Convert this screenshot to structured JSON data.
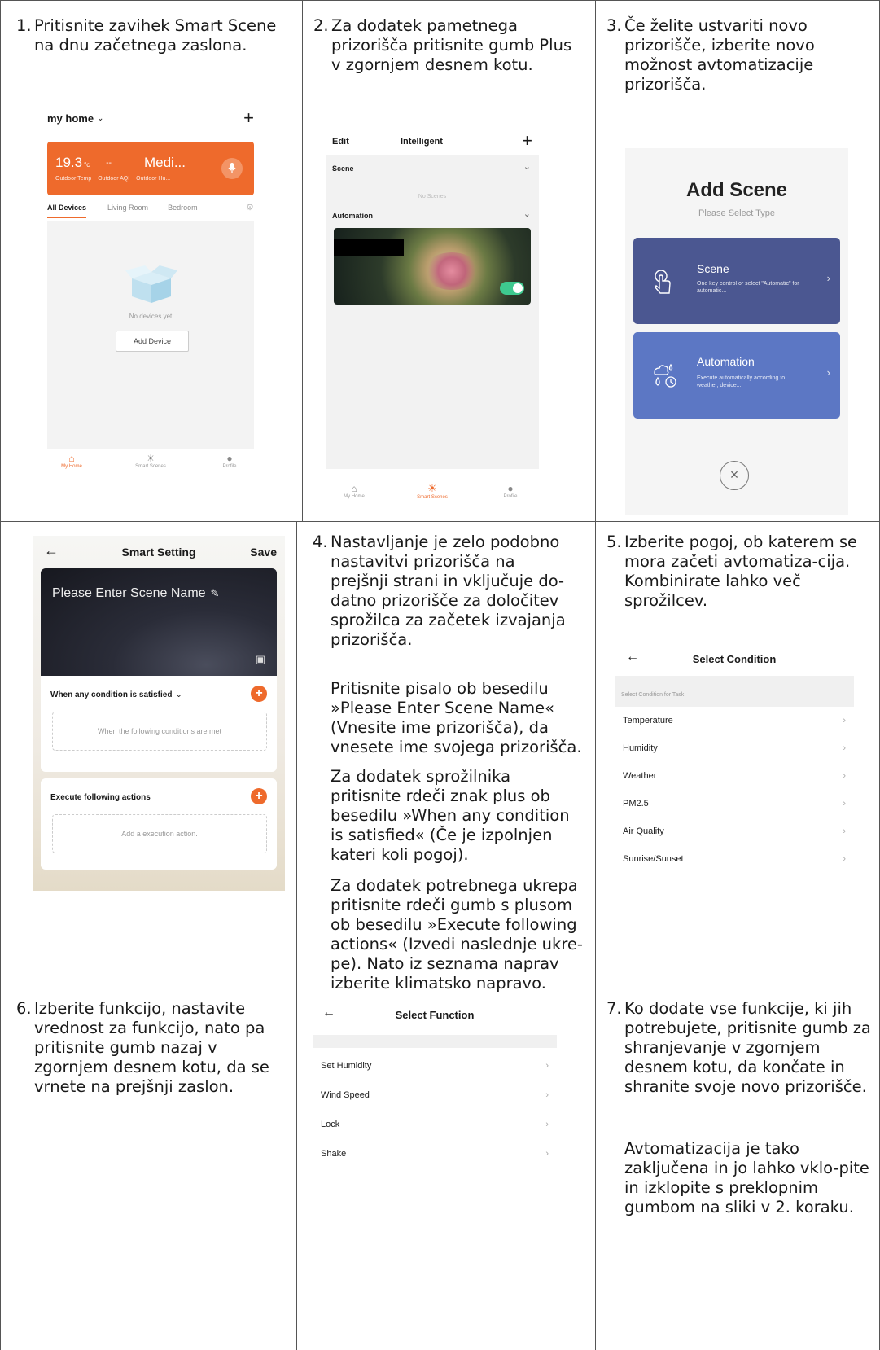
{
  "steps": {
    "s1": {
      "num": "1.",
      "text": "Pritisnite zavihek Smart Scene na dnu začetnega zaslona."
    },
    "s2": {
      "num": "2.",
      "text": "Za dodatek pametnega prizorišča pritisnite gumb Plus v zgornjem desnem kotu."
    },
    "s3": {
      "num": "3.",
      "text": "Če želite ustvariti novo prizorišče, izberite novo možnost avtomatizacije prizorišča."
    },
    "s4": {
      "num": "4.",
      "text": "Nastavljanje je zelo podobno nastavitvi prizorišča na prejšnji strani in vključuje do-datno prizorišče za določitev sprožilca za začetek izvajanja prizorišča.",
      "p2": "Pritisnite pisalo ob besedilu »Please Enter Scene Name« (Vnesite ime prizorišča), da vnesete ime svojega prizorišča.",
      "p3": "Za dodatek sprožilnika pritisnite rdeči znak plus ob besedilu »When any condition is satisfied« (Če je izpolnjen kateri koli pogoj).",
      "p4": "Za dodatek potrebnega ukrepa pritisnite rdeči gumb s plusom ob besedilu »Execute following actions« (Izvedi naslednje ukre-pe). Nato iz seznama naprav izberite klimatsko napravo."
    },
    "s5": {
      "num": "5.",
      "text": "Izberite pogoj, ob katerem se mora začeti avtomatiza-cija. Kombinirate lahko več sprožilcev."
    },
    "s6": {
      "num": "6.",
      "text": "Izberite funkcijo, nastavite vrednost za funkcijo, nato pa pritisnite gumb nazaj v zgornjem desnem kotu, da se vrnete na prejšnji zaslon."
    },
    "s7": {
      "num": "7.",
      "text": "Ko dodate vse funkcije, ki jih potrebujete, pritisnite gumb za shranjevanje v zgornjem desnem kotu, da končate in shranite svoje novo prizorišče.",
      "p2": "Avtomatizacija je tako zaključena in jo lahko vklo-pite in izklopite s preklopnim gumbom na sliki v 2. koraku."
    }
  },
  "screen1": {
    "home_title": "my home",
    "weather_temp": "19.3",
    "weather_unit": "°c",
    "weather_dash": "--",
    "weather_status": "Medi...",
    "weather_labels": [
      "Outdoor Temp",
      "Outdoor AQI",
      "Outdoor Hu..."
    ],
    "tabs": [
      "All Devices",
      "Living Room",
      "Bedroom"
    ],
    "empty_text": "No devices yet",
    "add_device": "Add Device",
    "nav": [
      "My Home",
      "Smart Scenes",
      "Profile"
    ],
    "accent": "#ee6a2c"
  },
  "screen2": {
    "edit": "Edit",
    "title": "Intelligent",
    "scene_label": "Scene",
    "no_scenes": "No Scenes",
    "automation_label": "Automation",
    "nav": [
      "My Home",
      "Smart Scenes",
      "Profile"
    ]
  },
  "screen3": {
    "title": "Add Scene",
    "subtitle": "Please Select Type",
    "scene_title": "Scene",
    "scene_desc": "One key control or select \"Automatic\" for automatic...",
    "auto_title": "Automation",
    "auto_desc": "Execute automatically according to weather, device..."
  },
  "screen4": {
    "title": "Smart Setting",
    "save": "Save",
    "scene_name": "Please Enter Scene Name",
    "cond_header": "When any condition is satisfied",
    "cond_placeholder": "When the following conditions are met",
    "exec_header": "Execute following actions",
    "exec_placeholder": "Add a execution action."
  },
  "screen5": {
    "title": "Select Condition",
    "section": "Select Condition for Task",
    "items": [
      "Temperature",
      "Humidity",
      "Weather",
      "PM2.5",
      "Air Quality",
      "Sunrise/Sunset"
    ]
  },
  "screen6": {
    "title": "Select Function",
    "items": [
      "Set Humidity",
      "Wind Speed",
      "Lock",
      "Shake"
    ]
  }
}
